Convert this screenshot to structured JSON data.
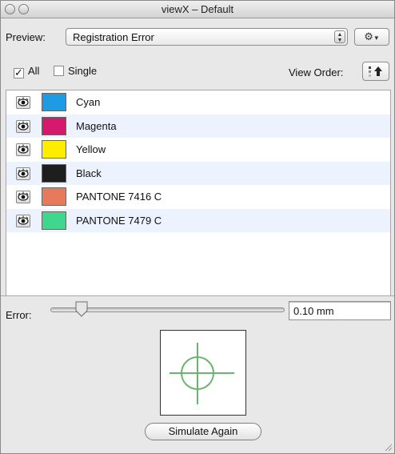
{
  "window": {
    "title": "viewX – Default"
  },
  "preview": {
    "label": "Preview:",
    "selected": "Registration Error",
    "gear_icon": "gear-icon",
    "dropdown_icon": "chevron-down-icon"
  },
  "options": {
    "all_label": "All",
    "all_checked": true,
    "single_label": "Single",
    "single_checked": false,
    "view_order_label": "View Order:",
    "view_order_icon": "sort-order-icon"
  },
  "separations": [
    {
      "name": "Cyan",
      "color": "#1e9be3",
      "visible": true
    },
    {
      "name": "Magenta",
      "color": "#d51a6e",
      "visible": true
    },
    {
      "name": "Yellow",
      "color": "#ffed00",
      "visible": true
    },
    {
      "name": "Black",
      "color": "#1e1e1e",
      "visible": true
    },
    {
      "name": "PANTONE 7416 C",
      "color": "#e8795a",
      "visible": true
    },
    {
      "name": "PANTONE 7479 C",
      "color": "#3fd68d",
      "visible": true
    }
  ],
  "error": {
    "label": "Error:",
    "value": "0.10 mm",
    "slider_fraction": 0.1
  },
  "target": {
    "color": "#6ab56e"
  },
  "actions": {
    "simulate_label": "Simulate Again"
  }
}
